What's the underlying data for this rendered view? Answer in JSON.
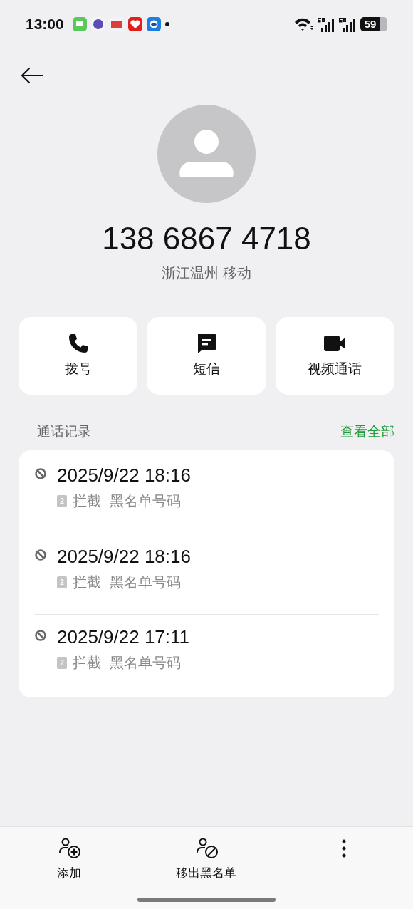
{
  "status_bar": {
    "time": "13:00",
    "battery": "59"
  },
  "contact": {
    "number": "138 6867 4718",
    "location": "浙江温州 移动"
  },
  "actions": [
    {
      "kind": "call",
      "label": "拨号"
    },
    {
      "kind": "message",
      "label": "短信"
    },
    {
      "kind": "video",
      "label": "视频通话"
    }
  ],
  "call_log": {
    "title": "通话记录",
    "view_all": "查看全部",
    "entries": [
      {
        "datetime": "2025/9/22 18:16",
        "sim": "2",
        "status": "拦截",
        "note": "黑名单号码"
      },
      {
        "datetime": "2025/9/22 18:16",
        "sim": "2",
        "status": "拦截",
        "note": "黑名单号码"
      },
      {
        "datetime": "2025/9/22 17:11",
        "sim": "2",
        "status": "拦截",
        "note": "黑名单号码"
      }
    ]
  },
  "bottom_actions": [
    {
      "kind": "add",
      "label": "添加"
    },
    {
      "kind": "unblock",
      "label": "移出黑名单"
    },
    {
      "kind": "more"
    }
  ]
}
